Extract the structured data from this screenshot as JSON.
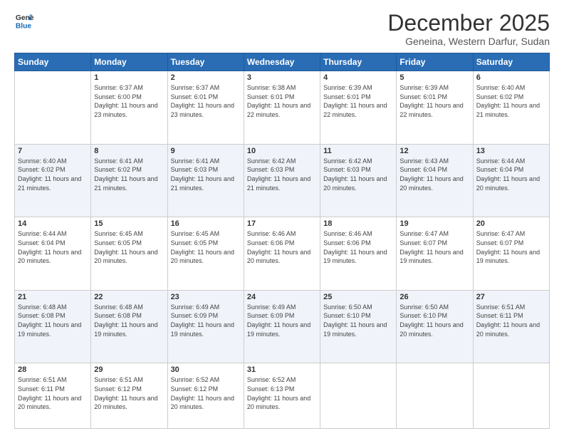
{
  "logo": {
    "line1": "General",
    "line2": "Blue"
  },
  "title": "December 2025",
  "subtitle": "Geneina, Western Darfur, Sudan",
  "weekdays": [
    "Sunday",
    "Monday",
    "Tuesday",
    "Wednesday",
    "Thursday",
    "Friday",
    "Saturday"
  ],
  "weeks": [
    [
      {
        "day": "",
        "sunrise": "",
        "sunset": "",
        "daylight": ""
      },
      {
        "day": "1",
        "sunrise": "Sunrise: 6:37 AM",
        "sunset": "Sunset: 6:00 PM",
        "daylight": "Daylight: 11 hours and 23 minutes."
      },
      {
        "day": "2",
        "sunrise": "Sunrise: 6:37 AM",
        "sunset": "Sunset: 6:01 PM",
        "daylight": "Daylight: 11 hours and 23 minutes."
      },
      {
        "day": "3",
        "sunrise": "Sunrise: 6:38 AM",
        "sunset": "Sunset: 6:01 PM",
        "daylight": "Daylight: 11 hours and 22 minutes."
      },
      {
        "day": "4",
        "sunrise": "Sunrise: 6:39 AM",
        "sunset": "Sunset: 6:01 PM",
        "daylight": "Daylight: 11 hours and 22 minutes."
      },
      {
        "day": "5",
        "sunrise": "Sunrise: 6:39 AM",
        "sunset": "Sunset: 6:01 PM",
        "daylight": "Daylight: 11 hours and 22 minutes."
      },
      {
        "day": "6",
        "sunrise": "Sunrise: 6:40 AM",
        "sunset": "Sunset: 6:02 PM",
        "daylight": "Daylight: 11 hours and 21 minutes."
      }
    ],
    [
      {
        "day": "7",
        "sunrise": "Sunrise: 6:40 AM",
        "sunset": "Sunset: 6:02 PM",
        "daylight": "Daylight: 11 hours and 21 minutes."
      },
      {
        "day": "8",
        "sunrise": "Sunrise: 6:41 AM",
        "sunset": "Sunset: 6:02 PM",
        "daylight": "Daylight: 11 hours and 21 minutes."
      },
      {
        "day": "9",
        "sunrise": "Sunrise: 6:41 AM",
        "sunset": "Sunset: 6:03 PM",
        "daylight": "Daylight: 11 hours and 21 minutes."
      },
      {
        "day": "10",
        "sunrise": "Sunrise: 6:42 AM",
        "sunset": "Sunset: 6:03 PM",
        "daylight": "Daylight: 11 hours and 21 minutes."
      },
      {
        "day": "11",
        "sunrise": "Sunrise: 6:42 AM",
        "sunset": "Sunset: 6:03 PM",
        "daylight": "Daylight: 11 hours and 20 minutes."
      },
      {
        "day": "12",
        "sunrise": "Sunrise: 6:43 AM",
        "sunset": "Sunset: 6:04 PM",
        "daylight": "Daylight: 11 hours and 20 minutes."
      },
      {
        "day": "13",
        "sunrise": "Sunrise: 6:44 AM",
        "sunset": "Sunset: 6:04 PM",
        "daylight": "Daylight: 11 hours and 20 minutes."
      }
    ],
    [
      {
        "day": "14",
        "sunrise": "Sunrise: 6:44 AM",
        "sunset": "Sunset: 6:04 PM",
        "daylight": "Daylight: 11 hours and 20 minutes."
      },
      {
        "day": "15",
        "sunrise": "Sunrise: 6:45 AM",
        "sunset": "Sunset: 6:05 PM",
        "daylight": "Daylight: 11 hours and 20 minutes."
      },
      {
        "day": "16",
        "sunrise": "Sunrise: 6:45 AM",
        "sunset": "Sunset: 6:05 PM",
        "daylight": "Daylight: 11 hours and 20 minutes."
      },
      {
        "day": "17",
        "sunrise": "Sunrise: 6:46 AM",
        "sunset": "Sunset: 6:06 PM",
        "daylight": "Daylight: 11 hours and 20 minutes."
      },
      {
        "day": "18",
        "sunrise": "Sunrise: 6:46 AM",
        "sunset": "Sunset: 6:06 PM",
        "daylight": "Daylight: 11 hours and 19 minutes."
      },
      {
        "day": "19",
        "sunrise": "Sunrise: 6:47 AM",
        "sunset": "Sunset: 6:07 PM",
        "daylight": "Daylight: 11 hours and 19 minutes."
      },
      {
        "day": "20",
        "sunrise": "Sunrise: 6:47 AM",
        "sunset": "Sunset: 6:07 PM",
        "daylight": "Daylight: 11 hours and 19 minutes."
      }
    ],
    [
      {
        "day": "21",
        "sunrise": "Sunrise: 6:48 AM",
        "sunset": "Sunset: 6:08 PM",
        "daylight": "Daylight: 11 hours and 19 minutes."
      },
      {
        "day": "22",
        "sunrise": "Sunrise: 6:48 AM",
        "sunset": "Sunset: 6:08 PM",
        "daylight": "Daylight: 11 hours and 19 minutes."
      },
      {
        "day": "23",
        "sunrise": "Sunrise: 6:49 AM",
        "sunset": "Sunset: 6:09 PM",
        "daylight": "Daylight: 11 hours and 19 minutes."
      },
      {
        "day": "24",
        "sunrise": "Sunrise: 6:49 AM",
        "sunset": "Sunset: 6:09 PM",
        "daylight": "Daylight: 11 hours and 19 minutes."
      },
      {
        "day": "25",
        "sunrise": "Sunrise: 6:50 AM",
        "sunset": "Sunset: 6:10 PM",
        "daylight": "Daylight: 11 hours and 19 minutes."
      },
      {
        "day": "26",
        "sunrise": "Sunrise: 6:50 AM",
        "sunset": "Sunset: 6:10 PM",
        "daylight": "Daylight: 11 hours and 20 minutes."
      },
      {
        "day": "27",
        "sunrise": "Sunrise: 6:51 AM",
        "sunset": "Sunset: 6:11 PM",
        "daylight": "Daylight: 11 hours and 20 minutes."
      }
    ],
    [
      {
        "day": "28",
        "sunrise": "Sunrise: 6:51 AM",
        "sunset": "Sunset: 6:11 PM",
        "daylight": "Daylight: 11 hours and 20 minutes."
      },
      {
        "day": "29",
        "sunrise": "Sunrise: 6:51 AM",
        "sunset": "Sunset: 6:12 PM",
        "daylight": "Daylight: 11 hours and 20 minutes."
      },
      {
        "day": "30",
        "sunrise": "Sunrise: 6:52 AM",
        "sunset": "Sunset: 6:12 PM",
        "daylight": "Daylight: 11 hours and 20 minutes."
      },
      {
        "day": "31",
        "sunrise": "Sunrise: 6:52 AM",
        "sunset": "Sunset: 6:13 PM",
        "daylight": "Daylight: 11 hours and 20 minutes."
      },
      {
        "day": "",
        "sunrise": "",
        "sunset": "",
        "daylight": ""
      },
      {
        "day": "",
        "sunrise": "",
        "sunset": "",
        "daylight": ""
      },
      {
        "day": "",
        "sunrise": "",
        "sunset": "",
        "daylight": ""
      }
    ]
  ]
}
